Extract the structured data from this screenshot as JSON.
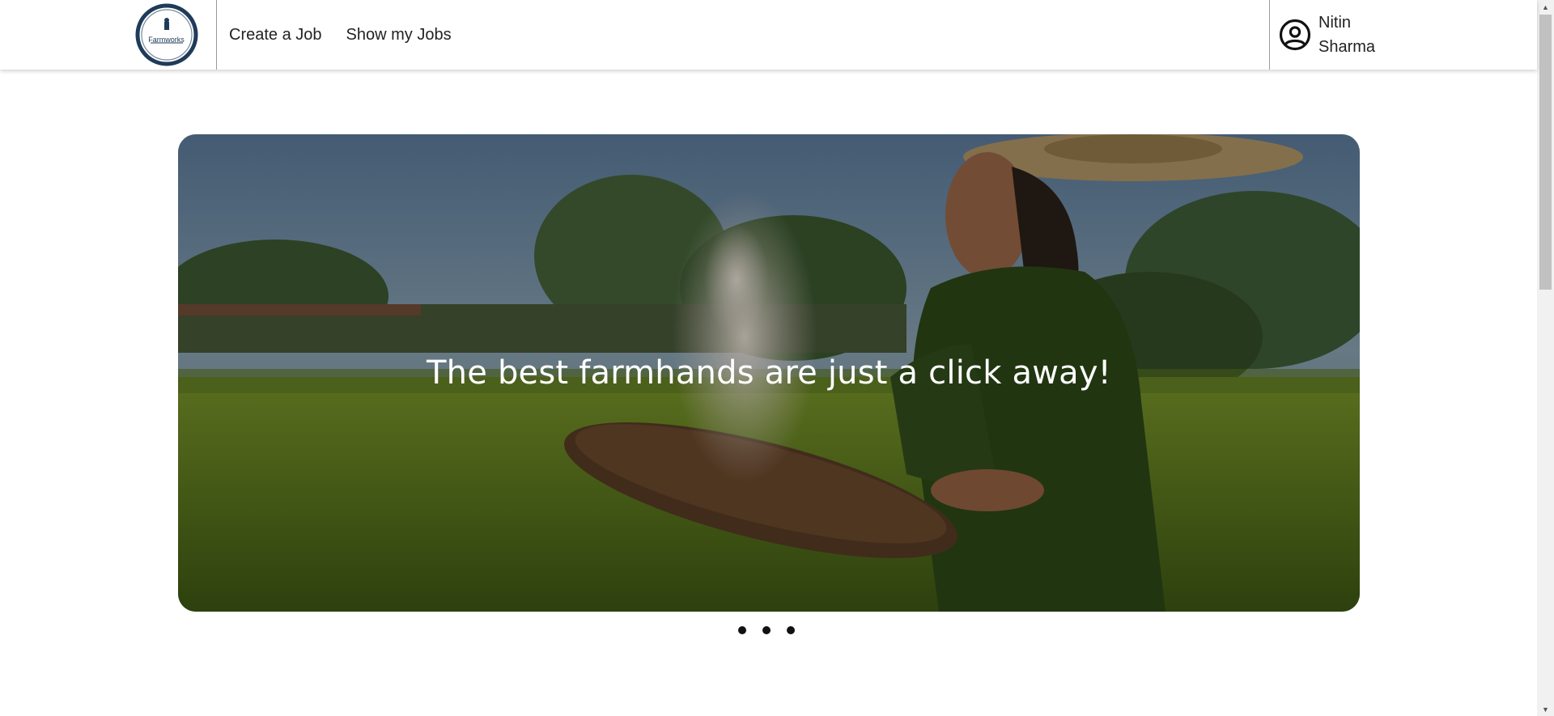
{
  "brand": {
    "logo_text": "Farmworks"
  },
  "nav": {
    "create_job": "Create a Job",
    "show_jobs": "Show my Jobs"
  },
  "user": {
    "first_name": "Nitin",
    "last_name": "Sharma",
    "icon": "user-circle-icon"
  },
  "carousel": {
    "caption": "The best farmhands are just a click away!",
    "slide_count": 3,
    "active_index": 0
  },
  "colors": {
    "logo_ring": "#1f3b5a",
    "caption": "#ffffff",
    "dot": "#111111"
  }
}
